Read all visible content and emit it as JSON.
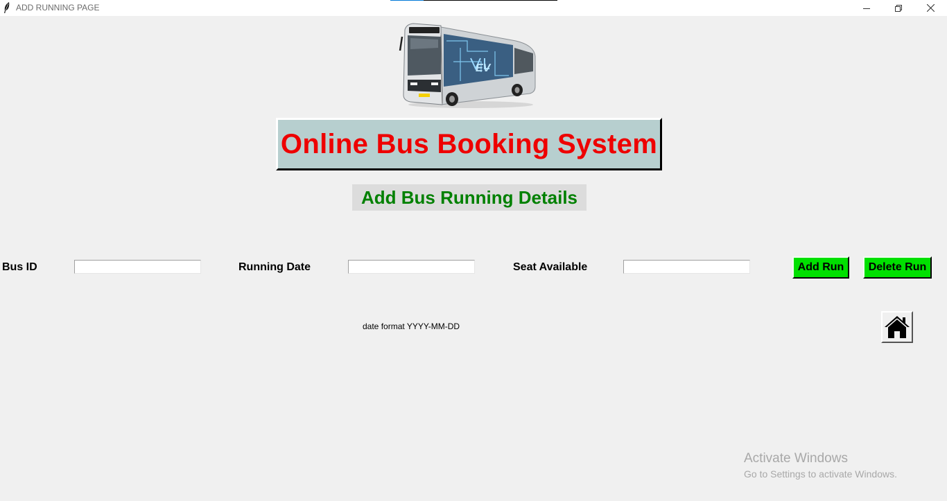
{
  "window": {
    "title": "ADD RUNNING PAGE",
    "app_icon": "feather-icon",
    "controls": [
      "minimize-icon",
      "restore-icon",
      "close-icon"
    ]
  },
  "header": {
    "image": "bus-image",
    "image_badge_text": "EV",
    "app_title": "Online Bus Booking System",
    "subtitle": "Add Bus Running Details"
  },
  "form": {
    "bus_id_label": "Bus ID",
    "bus_id_value": "",
    "running_date_label": "Running Date",
    "running_date_value": "",
    "seat_available_label": "Seat Available",
    "seat_available_value": "",
    "add_button": "Add Run",
    "delete_button": "Delete Run",
    "date_hint": "date format YYYY-MM-DD",
    "home_icon": "home-icon"
  },
  "watermark": {
    "line1": "Activate Windows",
    "line2": "Go to Settings to activate Windows."
  },
  "colors": {
    "background": "#f0f0f0",
    "title_bg": "#b7cfcf",
    "title_text": "#ee0000",
    "subtitle_text": "#008000",
    "subtitle_bg": "#dcdcdc",
    "button_green": "#00e000"
  }
}
